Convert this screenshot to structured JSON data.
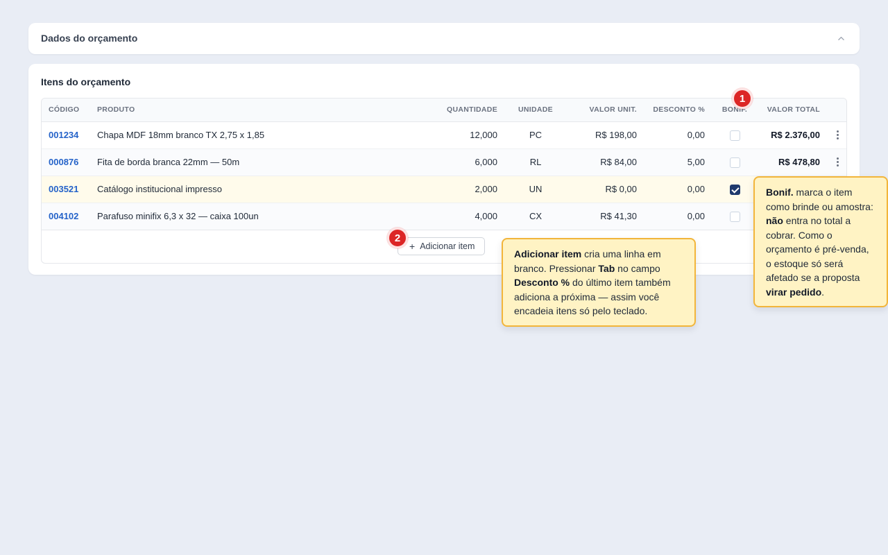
{
  "section_budget_data": {
    "title": "Dados do orçamento"
  },
  "section_items": {
    "title": "Itens do orçamento"
  },
  "table": {
    "headers": {
      "code": "CÓDIGO",
      "product": "PRODUTO",
      "quantity": "QUANTIDADE",
      "unit": "UNIDADE",
      "unit_value": "VALOR UNIT.",
      "discount": "DESCONTO %",
      "bonus": "BONIF.",
      "total": "VALOR TOTAL"
    },
    "rows": [
      {
        "code": "001234",
        "product": "Chapa MDF 18mm branco TX 2,75 x 1,85",
        "quantity": "12,000",
        "unit": "PC",
        "unit_value": "R$ 198,00",
        "discount": "0,00",
        "bonus": false,
        "total": "R$ 2.376,00"
      },
      {
        "code": "000876",
        "product": "Fita de borda branca 22mm — 50m",
        "quantity": "6,000",
        "unit": "RL",
        "unit_value": "R$ 84,00",
        "discount": "5,00",
        "bonus": false,
        "total": "R$ 478,80"
      },
      {
        "code": "003521",
        "product": "Catálogo institucional impresso",
        "quantity": "2,000",
        "unit": "UN",
        "unit_value": "R$ 0,00",
        "discount": "0,00",
        "bonus": true,
        "total": ""
      },
      {
        "code": "004102",
        "product": "Parafuso minifix 6,3 x 32 — caixa 100un",
        "quantity": "4,000",
        "unit": "CX",
        "unit_value": "R$ 41,30",
        "discount": "0,00",
        "bonus": false,
        "total": ""
      }
    ]
  },
  "add_item_button": {
    "label": "Adicionar item",
    "icon": "plus-icon"
  },
  "badges": {
    "bonus": "1",
    "add_item": "2"
  },
  "tooltips": {
    "add_item": [
      {
        "text": "Adicionar item",
        "bold": true
      },
      {
        "text": " cria uma linha em branco. Pressionar ",
        "bold": false
      },
      {
        "text": "Tab",
        "bold": true
      },
      {
        "text": " no campo ",
        "bold": false
      },
      {
        "text": "Desconto %",
        "bold": true
      },
      {
        "text": " do último item também adiciona a próxima — assim você encadeia itens só pelo teclado.",
        "bold": false
      }
    ],
    "bonus": [
      {
        "text": "Bonif.",
        "bold": true
      },
      {
        "text": " marca o item como brinde ou amostra: ",
        "bold": false
      },
      {
        "text": "não",
        "bold": true
      },
      {
        "text": " entra no total a cobrar. Como o orçamento é pré-venda, o estoque só será afetado se a proposta ",
        "bold": false
      },
      {
        "text": "virar pedido",
        "bold": true
      },
      {
        "text": ".",
        "bold": false
      }
    ]
  },
  "colors": {
    "background": "#e9edf5",
    "code_link": "#2563c9",
    "badge": "#dc2626",
    "tooltip_bg": "#fff3c4",
    "tooltip_border": "#f2b53a",
    "checkbox_checked": "#1f3a6e",
    "highlight_row": "#fffbeb"
  }
}
